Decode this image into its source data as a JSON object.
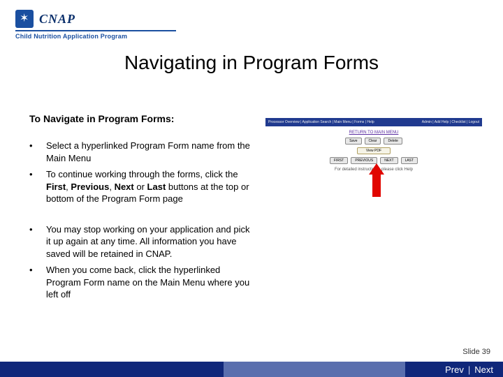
{
  "logo": {
    "acronym": "CNAP",
    "subtitle": "Child Nutrition Application Program"
  },
  "title": "Navigating in Program Forms",
  "subtitle": "To Navigate in Program Forms:",
  "bullets": {
    "b1": "Select a hyperlinked Program Form name from the Main Menu",
    "b2_pre": "To continue working through the forms, click the ",
    "b2_first": "First",
    "b2_c1": ", ",
    "b2_prev": "Previous",
    "b2_c2": ", ",
    "b2_next": "Next",
    "b2_or": " or ",
    "b2_last": "Last",
    "b2_post": " buttons at the top or bottom of the Program Form page",
    "b3": "You may stop working on your application and pick it up again at any time.  All information you have saved will be retained in CNAP.",
    "b4": "When you come back, click the hyperlinked Program Form name on the Main Menu where you left off"
  },
  "screenshot": {
    "bar_left": "Processor Overview | Application Search | Main Menu | Forms | Help",
    "bar_right": "Admin | Add Help | Checklist | Logout",
    "return_link": "RETURN TO MAIN MENU",
    "btn_save": "Save",
    "btn_clear": "Clear",
    "btn_delete": "Delete",
    "btn_pdf": "View PDF",
    "btn_first": "FIRST",
    "btn_prev": "PREVIOUS",
    "btn_next": "NEXT",
    "btn_last": "LAST",
    "help_text": "For detailed instructions, please click Help"
  },
  "footer": {
    "slide_label": "Slide 39",
    "prev": "Prev",
    "next": "Next",
    "sep": "|"
  }
}
